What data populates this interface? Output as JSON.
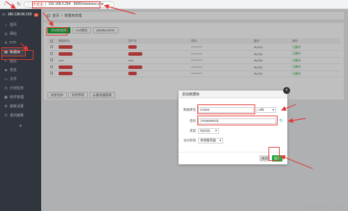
{
  "browser": {
    "back_icon": "arrow-left-icon",
    "forward_icon": "arrow-right-icon",
    "reload_icon": "reload-icon",
    "insecure_label": "不安全",
    "address_host": "192.168.0.254",
    "address_path": ":8888/database.php"
  },
  "sidebar": {
    "server_ip": "180.138.66.159",
    "server_badge": "0",
    "items": [
      {
        "label": "首页",
        "icon": "home-icon"
      },
      {
        "label": "网站",
        "icon": "globe-icon"
      },
      {
        "label": "FTP",
        "icon": "ftp-icon"
      },
      {
        "label": "数据库",
        "icon": "database-icon"
      },
      {
        "label": "监控",
        "icon": "monitor-icon"
      },
      {
        "label": "安全",
        "icon": "shield-icon"
      },
      {
        "label": "文件",
        "icon": "folder-icon"
      },
      {
        "label": "计划任务",
        "icon": "clock-icon"
      },
      {
        "label": "软件管理",
        "icon": "apps-icon"
      },
      {
        "label": "面板设置",
        "icon": "gear-icon"
      },
      {
        "label": "退出面板",
        "icon": "logout-icon"
      }
    ],
    "add_label": "+"
  },
  "breadcrumb": {
    "home": "首页",
    "separator": "/",
    "current": "数据库管理"
  },
  "toolbar": {
    "add_db": "添加数据库",
    "root_pw": "root密码",
    "phpmyadmin": "phpMyAdmin"
  },
  "table": {
    "columns": [
      "",
      "数据库名",
      "用户名",
      "密码",
      "",
      "备份",
      "",
      "",
      "操作"
    ],
    "rows": [
      {
        "name": "",
        "user": "",
        "password": "**********",
        "backup": "MySQL",
        "status": "已备份"
      },
      {
        "name": "",
        "user": "",
        "password": "**********",
        "backup": "MySQL",
        "status": "已备份"
      },
      {
        "name": "root",
        "user": "root",
        "password": "**********",
        "backup": "MySQL",
        "status": "已备份"
      },
      {
        "name": "",
        "user": "",
        "password": "**********",
        "backup": "MySQL",
        "status": "已备份"
      },
      {
        "name": "",
        "user": "",
        "password": "**********",
        "backup": "MySQL",
        "status": "已备份"
      }
    ]
  },
  "batch": {
    "sync_selected": "同步选中",
    "sync_all": "同步所有",
    "fetch_server": "从服务器获取"
  },
  "dialog": {
    "title": "添加数据库",
    "name_label": "数据库名",
    "name_value": "cms54",
    "charset_value": "utf8",
    "password_label": "密码",
    "password_value": "1784659023|",
    "type_label": "类型",
    "type_value": "MySQL",
    "access_label": "访问权限",
    "access_value": "本地服务器",
    "cancel": "关闭",
    "submit": "提交",
    "close_icon": "close-icon",
    "refresh_icon": "refresh-icon"
  },
  "watermark": "https://blog.csdn.net/qq_74848969",
  "colors": {
    "accent_green": "#20a53a",
    "sidebar_bg": "#31353d",
    "annotation_red": "#e53935"
  }
}
